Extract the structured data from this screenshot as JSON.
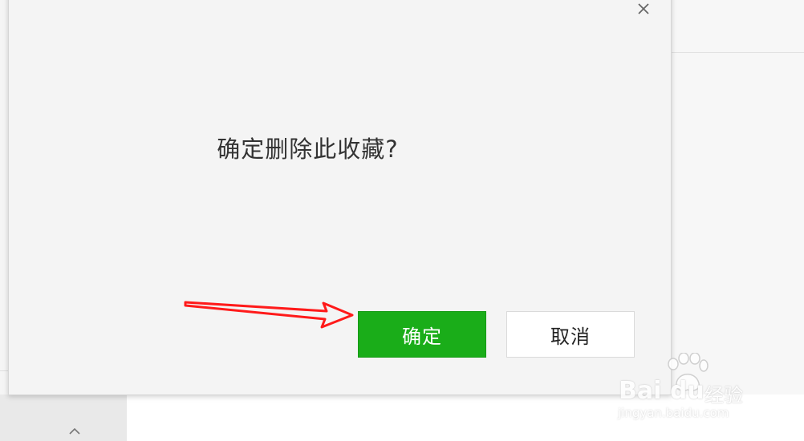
{
  "dialog": {
    "message": "确定删除此收藏?",
    "confirm_label": "确定",
    "cancel_label": "取消",
    "close_icon": "close-icon"
  },
  "watermark": {
    "brand": "Bai  du",
    "sub": "经验",
    "url": "jingyan.baidu.com"
  },
  "colors": {
    "confirm_bg": "#1aad19",
    "dialog_bg": "#f4f4f4",
    "annotation": "#ff0000"
  }
}
